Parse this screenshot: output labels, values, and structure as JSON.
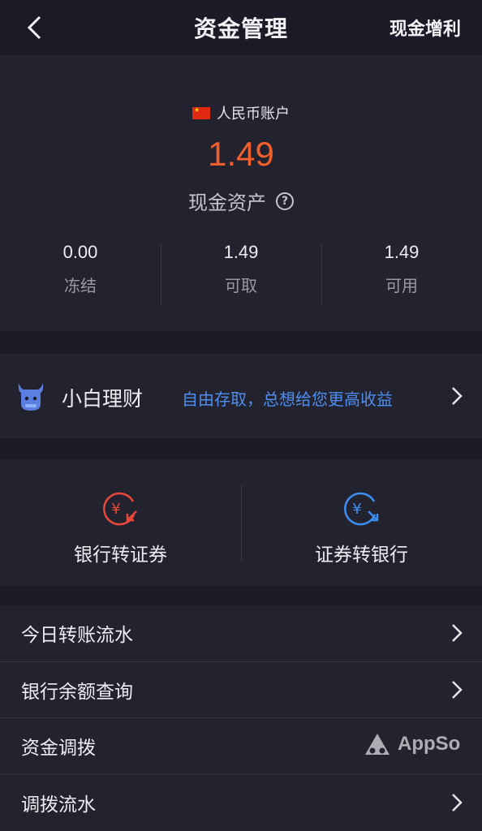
{
  "header": {
    "title": "资金管理",
    "action": "现金增利"
  },
  "account": {
    "label": "人民币账户",
    "amount": "1.49",
    "asset_label": "现金资产",
    "stats": [
      {
        "value": "0.00",
        "label": "冻结"
      },
      {
        "value": "1.49",
        "label": "可取"
      },
      {
        "value": "1.49",
        "label": "可用"
      }
    ]
  },
  "wealth": {
    "title": "小白理财",
    "slogan": "自由存取，总想给您更高收益"
  },
  "transfer": {
    "bank_to_securities": "银行转证券",
    "securities_to_bank": "证券转银行"
  },
  "list": {
    "items": [
      {
        "label": "今日转账流水"
      },
      {
        "label": "银行余额查询"
      },
      {
        "label": "资金调拨"
      },
      {
        "label": "调拨流水"
      }
    ]
  },
  "watermark": "AppSo",
  "colors": {
    "background": "#1b1a26",
    "panel": "#23222f",
    "amount": "#f0602e",
    "link": "#4d8ef0",
    "bank_to_securities_icon": "#e8473a",
    "securities_to_bank_icon": "#3d8ef0"
  }
}
